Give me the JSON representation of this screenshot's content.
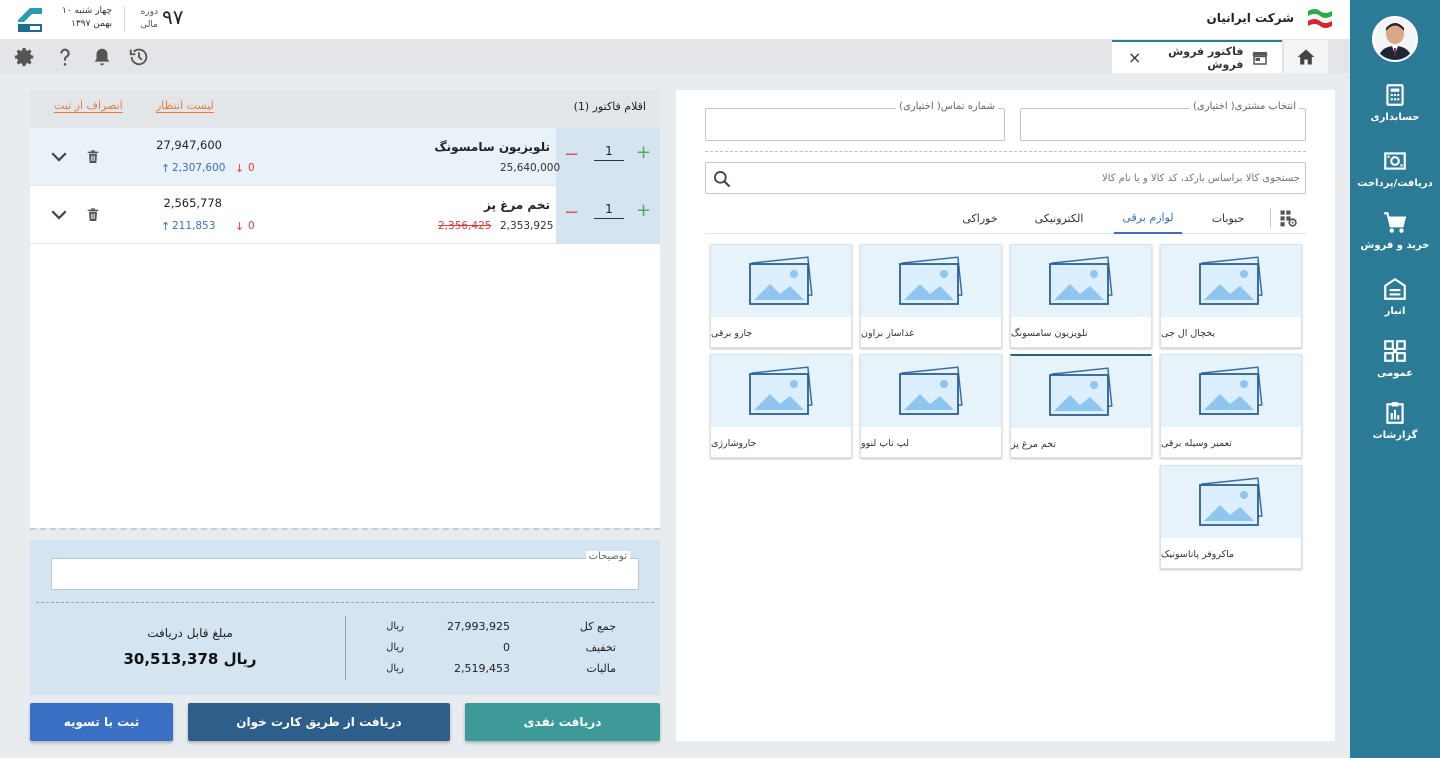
{
  "header": {
    "company_name": "شرکت ایرانیان",
    "period_number": "۹۷",
    "period_label_1": "دوره",
    "period_label_2": "مالی",
    "date_line_1": "چهار شنبه ۱۰",
    "date_line_2": "بهمن ۱۳۹۷"
  },
  "tab": {
    "label": "فاکتور فروش فروش",
    "close_symbol": "×"
  },
  "sidebar": {
    "items": [
      {
        "label": "حسابداری",
        "icon": "accounting-icon"
      },
      {
        "label": "دریافت/پرداخت",
        "icon": "payment-icon"
      },
      {
        "label": "خرید و فروش",
        "icon": "cart-icon"
      },
      {
        "label": "انبار",
        "icon": "warehouse-icon"
      },
      {
        "label": "عمومی",
        "icon": "general-icon"
      },
      {
        "label": "گزارشات",
        "icon": "reports-icon"
      }
    ]
  },
  "customer": {
    "customer_legend": "انتخاب مشتری( اختیاری)",
    "phone_legend": "شماره تماس( اختیاری)",
    "customer_value": "",
    "phone_value": ""
  },
  "search": {
    "placeholder": "جستجوی کالا براساس بارکد، کد کالا و یا نام کالا"
  },
  "categories": [
    "حبوبات",
    "لوازم برقی",
    "الکترونیکی",
    "خوراکی"
  ],
  "active_category": "لوازم برقی",
  "products": [
    "یخچال ال جی",
    "تلویزیون سامسونگ",
    "غذاساز براون",
    "جارو برقی",
    "تعمیر وسیله برقی",
    "تخم مرغ پز",
    "لپ تاپ لنوو",
    "جاروشارژی",
    "ماکروفر پاناسونیک"
  ],
  "invoice": {
    "title": "اقلام فاکتور (1)",
    "waitlist_label": "لیست انتظار",
    "cancel_label": "انصراف از ثبت",
    "items": [
      {
        "name": "تلویزیون سامسونگ",
        "qty": "1",
        "price": "25,640,000",
        "old_price": "",
        "total": "27,947,600",
        "up": "2,307,600",
        "down": "0"
      },
      {
        "name": "تخم مرغ پز",
        "qty": "1",
        "price": "2,353,925",
        "old_price": "2,356,425",
        "total": "2,565,778",
        "up": "211,853",
        "down": "0"
      }
    ]
  },
  "summary": {
    "notes_legend": "توضیحات",
    "notes_value": "",
    "rows": [
      {
        "label": "جمع کل",
        "value": "27,993,925",
        "unit": "ریال"
      },
      {
        "label": "تخفیف",
        "value": "0",
        "unit": "ریال"
      },
      {
        "label": "مالیات",
        "value": "2,519,453",
        "unit": "ریال"
      }
    ],
    "payable_label": "مبلغ قابل دریافت",
    "payable_value": "30,513,378 ریال"
  },
  "buttons": {
    "cash": "دریافت نقدی",
    "card": "دریافت از طریق کارت خوان",
    "settle": "ثبت با تسویه"
  },
  "colors": {
    "sidebar": "#2b7a96",
    "cash_button": "#3e9a98",
    "card_button": "#2e5f8a",
    "settle_button": "#3a6fc4",
    "link_orange": "#e87b3c",
    "up_blue": "#3a6fc4",
    "down_red": "#e03b3b",
    "plus_green": "#4caf50",
    "minus_red": "#e05050"
  }
}
